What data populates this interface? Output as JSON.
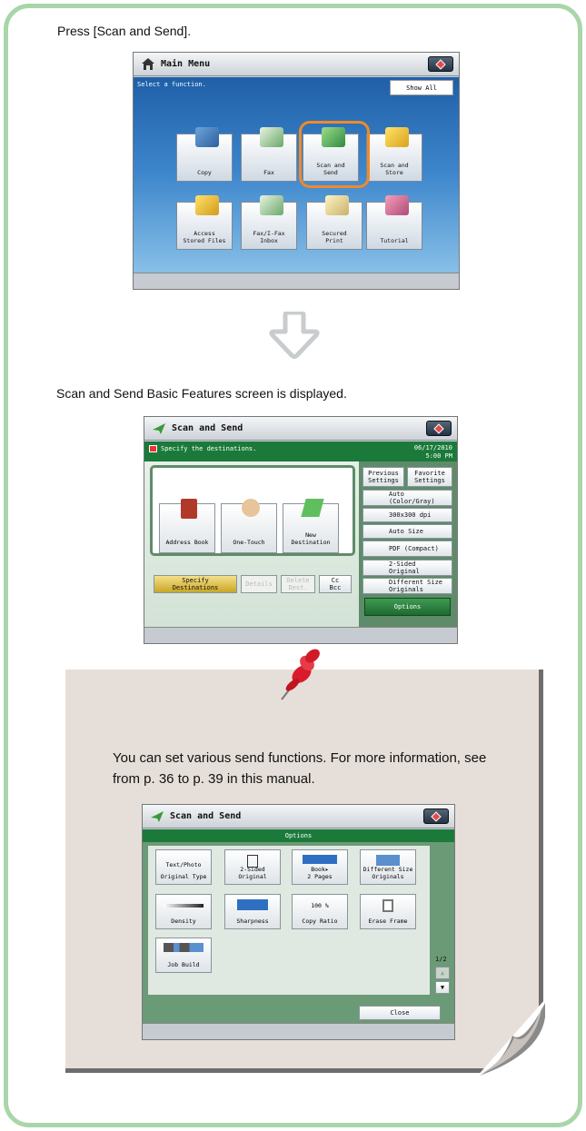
{
  "instructions": {
    "step1": "Press [Scan and Send].",
    "step2": "Scan and Send Basic Features screen is displayed."
  },
  "main_menu": {
    "title": "Main Menu",
    "hint": "Select a function.",
    "show_all": "Show All",
    "tiles": [
      {
        "label": "Copy"
      },
      {
        "label": "Fax"
      },
      {
        "label": "Scan and\nSend"
      },
      {
        "label": "Scan and\nStore"
      },
      {
        "label": "Access\nStored Files"
      },
      {
        "label": "Fax/I-Fax\nInbox"
      },
      {
        "label": "Secured\nPrint"
      },
      {
        "label": "Tutorial"
      }
    ]
  },
  "scan_send": {
    "title": "Scan and Send",
    "hint": "Specify the destinations.",
    "date": "06/17/2010",
    "time": "5:00 PM",
    "dest_tiles": [
      "Address Book",
      "One-Touch",
      "New\nDestination"
    ],
    "specify": "Specify\nDestinations",
    "details": "Details",
    "delete": "Delete\nDest.",
    "ccbcc": "Cc\nBcc",
    "previous": "Previous\nSettings",
    "favorite": "Favorite\nSettings",
    "color": "Auto\n(Color/Gray)",
    "resolution": "300x300 dpi",
    "size": "Auto Size",
    "format": "PDF (Compact)",
    "sided": "2-Sided\nOriginal",
    "diffsize": "Different Size\nOriginals",
    "options": "Options"
  },
  "note": {
    "text": "You can set various send functions. For more information, see from p. 36 to p. 39 in this manual."
  },
  "options_screen": {
    "title": "Scan and Send",
    "header": "Options",
    "tiles": [
      {
        "top": "Text/Photo",
        "label": "Original Type"
      },
      {
        "top": "",
        "label": "2-Sided\nOriginal"
      },
      {
        "top": "",
        "label": "Book▸\n2 Pages"
      },
      {
        "top": "",
        "label": "Different Size\nOriginals"
      },
      {
        "top": "",
        "label": "Density"
      },
      {
        "top": "",
        "label": "Sharpness"
      },
      {
        "top": "100 %",
        "label": "Copy Ratio"
      },
      {
        "top": "",
        "label": "Erase Frame"
      },
      {
        "top": "",
        "label": "Job Build"
      }
    ],
    "page": "1/2",
    "close": "Close"
  },
  "colors": {
    "frame": "#a9d6a8",
    "highlight": "#f08a2a",
    "green_bar": "#1b7a3a",
    "note_bg": "#e6dfd9"
  }
}
